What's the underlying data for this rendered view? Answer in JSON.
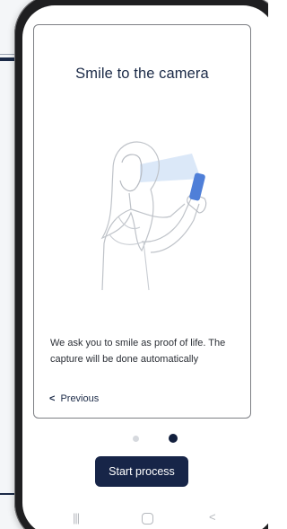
{
  "onboarding": {
    "title": "Smile to the camera",
    "description": "We ask you to smile as proof of life. The capture will be done automatically",
    "previous_label": "Previous",
    "previous_icon": "chevron-left-icon",
    "illustration": "woman-taking-selfie-illustration"
  },
  "pagination": {
    "total_steps": 2,
    "current_step": 2
  },
  "actions": {
    "start_label": "Start process"
  },
  "colors": {
    "primary": "#172548",
    "title": "#1b2a47",
    "dot_inactive": "#d6d9de",
    "phone_accent": "#4f7fd8"
  },
  "navbar": {
    "recents_icon": "recents-icon",
    "home_icon": "home-icon",
    "back_icon": "back-icon"
  }
}
